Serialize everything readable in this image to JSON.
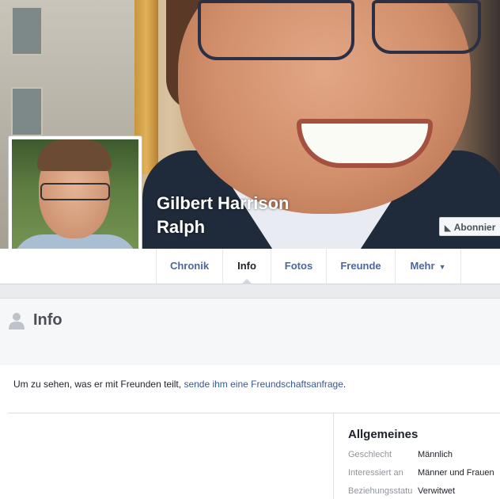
{
  "profile": {
    "name_line1": "Gilbert Harrison",
    "name_line2": "Ralph",
    "subscribe_label": "Abonnier"
  },
  "tabs": [
    {
      "label": "Chronik",
      "active": false
    },
    {
      "label": "Info",
      "active": true
    },
    {
      "label": "Fotos",
      "active": false
    },
    {
      "label": "Freunde",
      "active": false
    },
    {
      "label": "Mehr",
      "active": false
    }
  ],
  "info_section": {
    "title": "Info",
    "notice_prefix": "Um zu sehen, was er mit Freunden teilt,",
    "notice_link": "sende ihm eine Freundschaftsanfrage",
    "notice_suffix": "."
  },
  "general": {
    "title": "Allgemeines",
    "rows": [
      {
        "key": "Geschlecht",
        "value": "Männlich"
      },
      {
        "key": "Interessiert an",
        "value": "Männer und Frauen"
      },
      {
        "key": "Beziehungsstatu",
        "value": "Verwitwet"
      }
    ]
  },
  "colors": {
    "link": "#365899",
    "tab_text": "#4b67a1",
    "background": "#e9ebee"
  },
  "icons": {
    "subscribe": "rss-icon",
    "info_header": "user-silhouette-icon",
    "more_tab": "caret-down-icon"
  }
}
